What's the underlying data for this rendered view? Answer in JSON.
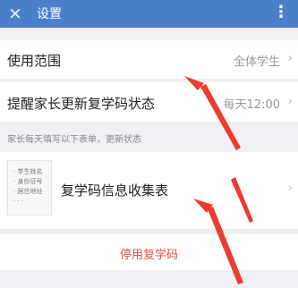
{
  "header": {
    "title": "设置",
    "close_icon": "×",
    "more_icon": "⋮"
  },
  "settings": {
    "scope": {
      "label": "使用范围",
      "value": "全体学生"
    },
    "remind": {
      "label": "提醒家长更新复学码状态",
      "value": "每天12:00"
    },
    "note": "家长每天填写以下表单，更新状态",
    "form": {
      "label": "复学码信息收集表",
      "thumb_lines": [
        "· 学生姓名",
        "· 身份证号",
        "· 居住地址",
        "· · ·"
      ]
    },
    "disable_label": "停用复学码"
  },
  "chevron": "›",
  "colors": {
    "header_bg": "#4a7fc9",
    "danger": "#e64b44",
    "arrow": "#ee3b2f"
  }
}
